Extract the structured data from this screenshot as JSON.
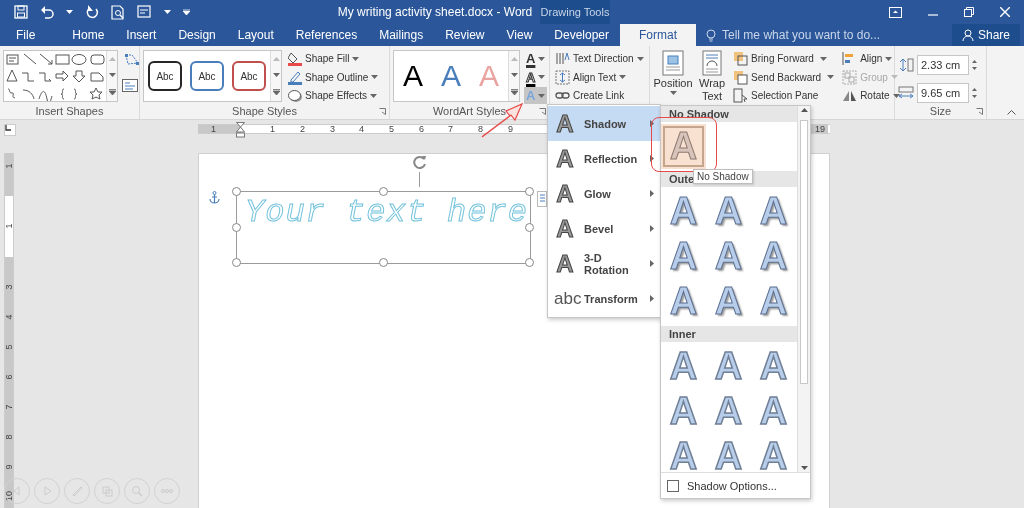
{
  "title_bar": {
    "title": "My writing activity sheet.docx - Word",
    "context_tab": "Drawing Tools"
  },
  "tabs": [
    {
      "label": "File",
      "selected": false
    },
    {
      "label": "Home",
      "selected": false
    },
    {
      "label": "Insert",
      "selected": false
    },
    {
      "label": "Design",
      "selected": false
    },
    {
      "label": "Layout",
      "selected": false
    },
    {
      "label": "References",
      "selected": false
    },
    {
      "label": "Mailings",
      "selected": false
    },
    {
      "label": "Review",
      "selected": false
    },
    {
      "label": "View",
      "selected": false
    },
    {
      "label": "Developer",
      "selected": false
    },
    {
      "label": "Format",
      "selected": true
    }
  ],
  "tell_me": {
    "placeholder": "Tell me what you want to do..."
  },
  "share": {
    "label": "Share"
  },
  "ribbon": {
    "insert_shapes": {
      "label": "Insert Shapes"
    },
    "shape_styles": {
      "label": "Shape Styles",
      "presets": [
        {
          "text": "Abc",
          "color": "#262626"
        },
        {
          "text": "Abc",
          "color": "#4a7ebb"
        },
        {
          "text": "Abc",
          "color": "#c0504d"
        }
      ],
      "commands": [
        "Shape Fill",
        "Shape Outline",
        "Shape Effects"
      ]
    },
    "wordart_styles": {
      "label": "WordArt Styles",
      "presets": [
        {
          "glyph": "A",
          "color": "#000000"
        },
        {
          "glyph": "A",
          "color": "#4a7ebb"
        },
        {
          "glyph": "A",
          "color": "#e9a3a0"
        }
      ],
      "effect_buttons": [
        {
          "glyph": "A",
          "kind": "fill",
          "pressed": false
        },
        {
          "glyph": "A",
          "kind": "outline",
          "pressed": false
        },
        {
          "glyph": "A",
          "kind": "effects",
          "pressed": true
        }
      ]
    },
    "text": {
      "commands": [
        "Text Direction",
        "Align Text",
        "Create Link"
      ]
    },
    "arrange": {
      "position": "Position",
      "wrap_text": "Wrap Text",
      "commands": [
        {
          "label": "Bring Forward",
          "disabled": false
        },
        {
          "label": "Send Backward",
          "disabled": false
        },
        {
          "label": "Selection Pane",
          "disabled": false
        }
      ],
      "commands_2": [
        {
          "label": "Align",
          "disabled": false
        },
        {
          "label": "Group",
          "disabled": true
        },
        {
          "label": "Rotate",
          "disabled": false
        }
      ]
    },
    "size": {
      "label": "Size",
      "fields": [
        {
          "kind": "height",
          "value": "2.33 cm"
        },
        {
          "kind": "width",
          "value": "9.65 cm"
        }
      ]
    }
  },
  "rulers": {
    "horizontal": [
      "1",
      "1",
      "2",
      "3",
      "4",
      "5",
      "6",
      "7",
      "8",
      "9",
      "19"
    ],
    "vertical": [
      "1",
      "1",
      "3",
      "4",
      "5",
      "6",
      "7",
      "8",
      "9",
      "10"
    ]
  },
  "document": {
    "wordart_text": "Your text here"
  },
  "effects_menu": [
    {
      "label": "Shadow",
      "glyph": "A",
      "selected": true
    },
    {
      "label": "Reflection",
      "glyph": "A",
      "selected": false
    },
    {
      "label": "Glow",
      "glyph": "A",
      "selected": false
    },
    {
      "label": "Bevel",
      "glyph": "A",
      "selected": false
    },
    {
      "label": "3-D Rotation",
      "glyph": "A",
      "selected": false
    },
    {
      "label": "Transform",
      "glyph": "abc",
      "selected": false
    }
  ],
  "shadow_gallery": {
    "sections": [
      {
        "kind": "none",
        "heading": "No Shadow",
        "items": [
          {
            "glyph": "A",
            "selected": true
          }
        ]
      },
      {
        "kind": "outer",
        "heading": "Oute",
        "items": [
          {
            "glyph": "A",
            "selected": false
          },
          {
            "glyph": "A",
            "selected": false
          },
          {
            "glyph": "A",
            "selected": false
          },
          {
            "glyph": "A",
            "selected": false
          },
          {
            "glyph": "A",
            "selected": false
          },
          {
            "glyph": "A",
            "selected": false
          },
          {
            "glyph": "A",
            "selected": false
          },
          {
            "glyph": "A",
            "selected": false
          },
          {
            "glyph": "A",
            "selected": false
          }
        ]
      },
      {
        "kind": "inner",
        "heading": "Inner",
        "items": [
          {
            "glyph": "A",
            "selected": false
          },
          {
            "glyph": "A",
            "selected": false
          },
          {
            "glyph": "A",
            "selected": false
          },
          {
            "glyph": "A",
            "selected": false
          },
          {
            "glyph": "A",
            "selected": false
          },
          {
            "glyph": "A",
            "selected": false
          },
          {
            "glyph": "A",
            "selected": false
          },
          {
            "glyph": "A",
            "selected": false
          },
          {
            "glyph": "A",
            "selected": false
          }
        ]
      }
    ],
    "tooltip": "No Shadow",
    "options": {
      "label": "Shadow Options...",
      "checked": false
    }
  }
}
